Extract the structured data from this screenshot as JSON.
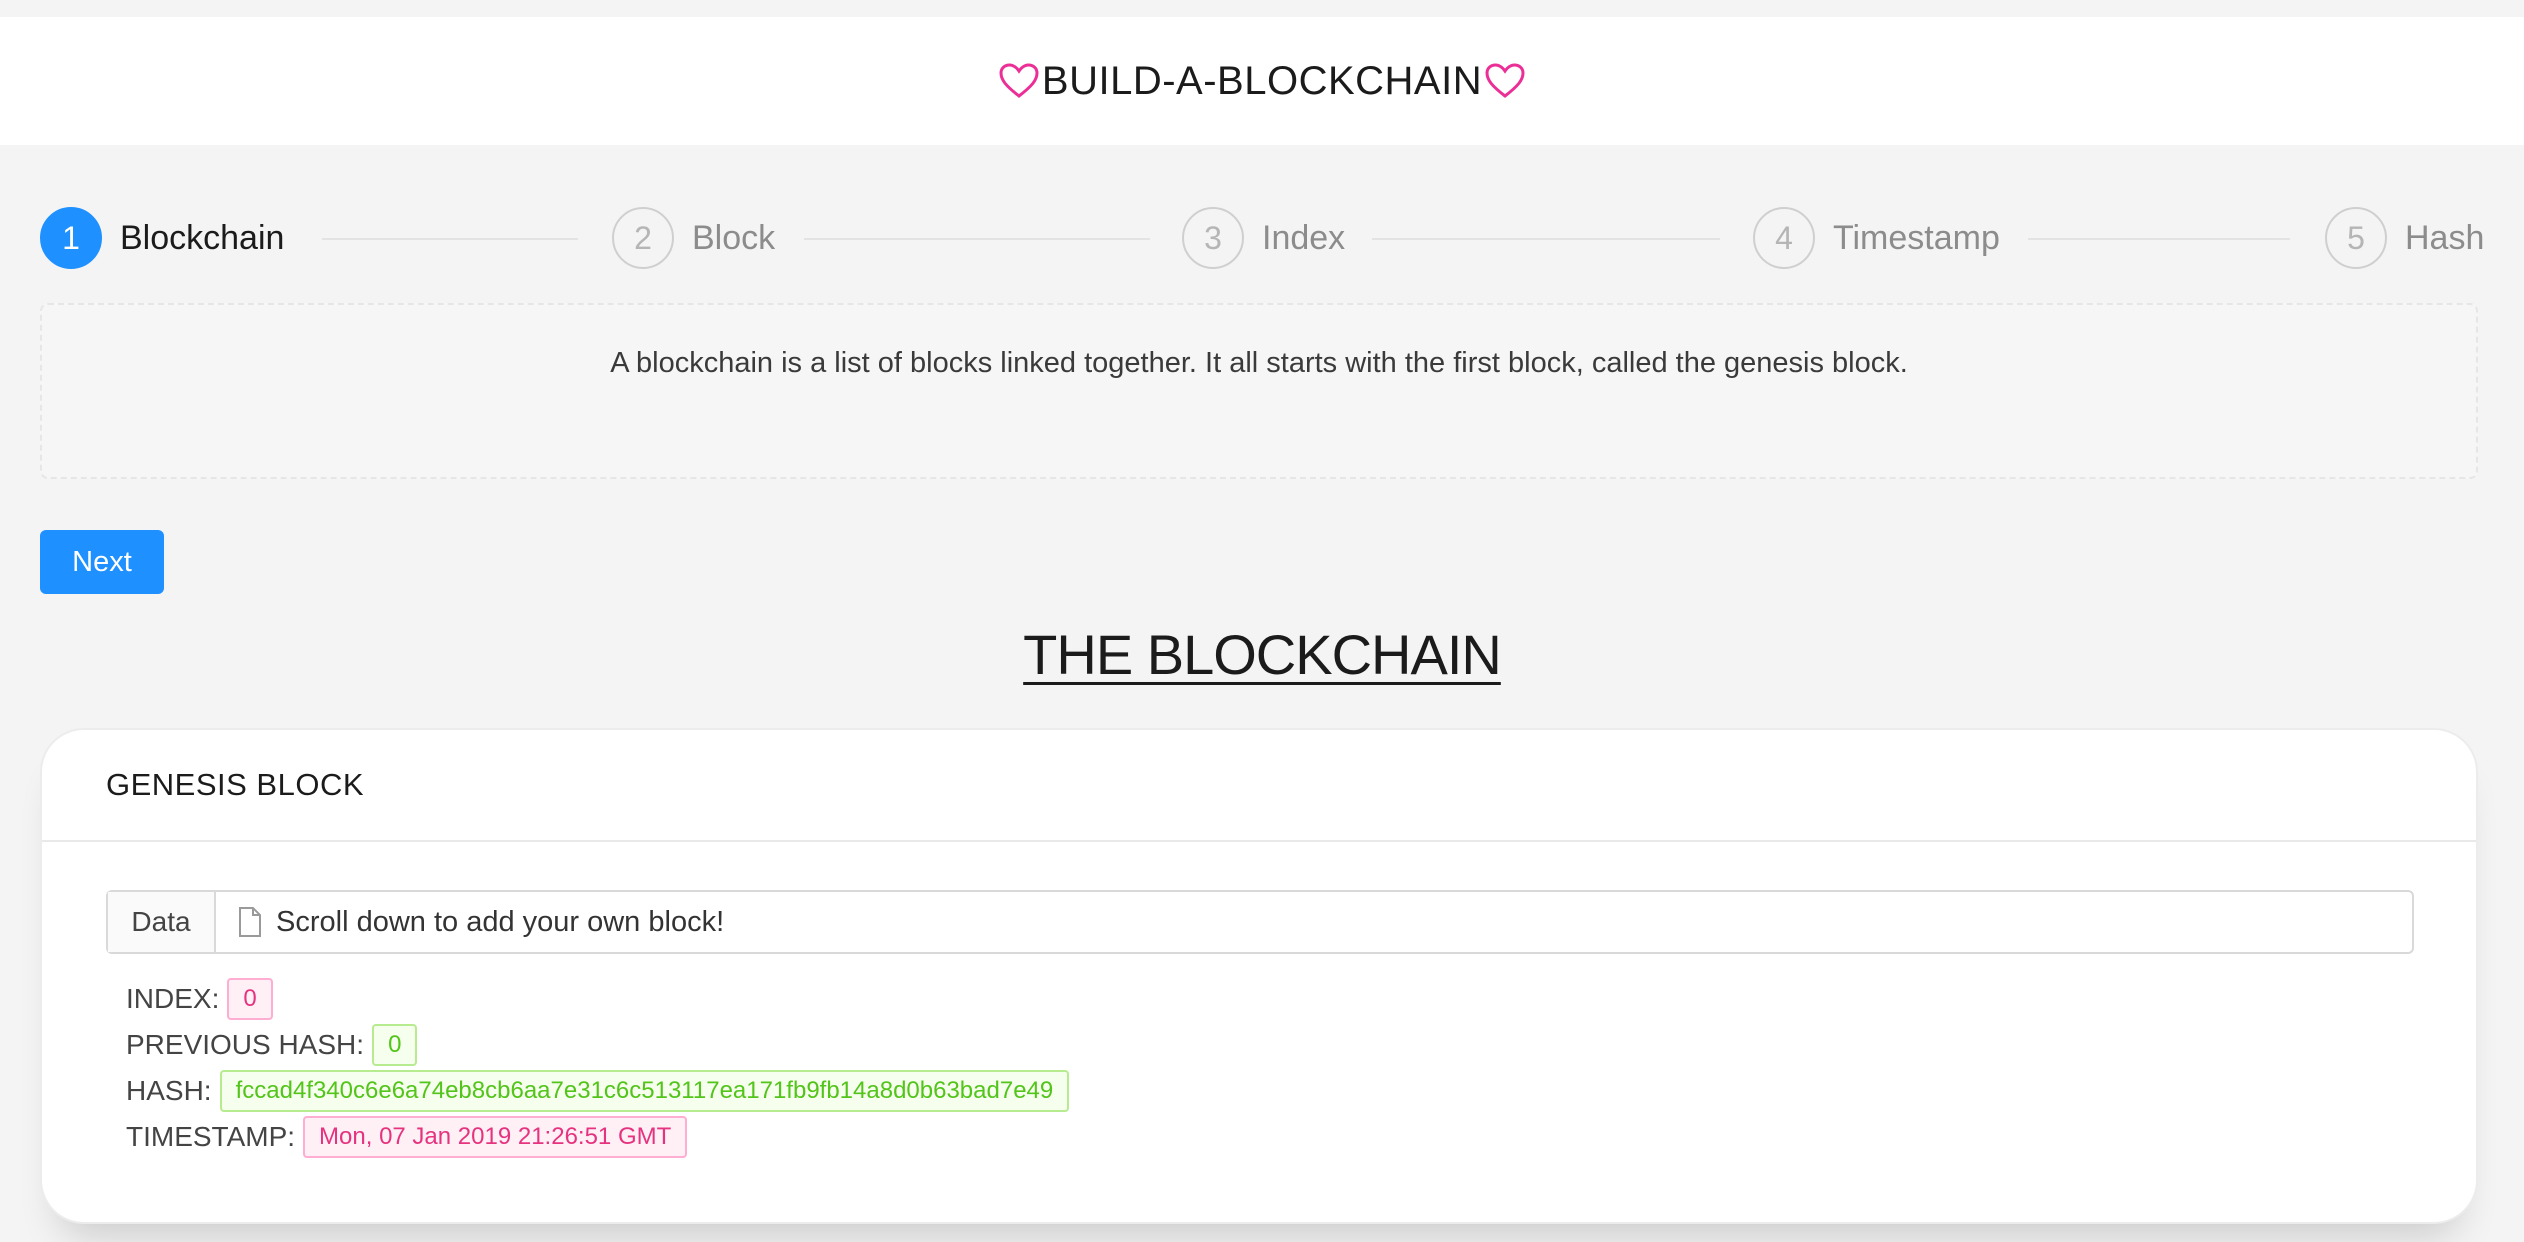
{
  "header": {
    "title": "BUILD-A-BLOCKCHAIN",
    "heart_icon_color": "#eb2f96"
  },
  "steps": [
    {
      "number": "1",
      "label": "Blockchain",
      "active": true
    },
    {
      "number": "2",
      "label": "Block",
      "active": false
    },
    {
      "number": "3",
      "label": "Index",
      "active": false
    },
    {
      "number": "4",
      "label": "Timestamp",
      "active": false
    },
    {
      "number": "5",
      "label": "Hash",
      "active": false
    }
  ],
  "description": "A blockchain is a list of blocks linked together. It all starts with the first block, called the genesis block.",
  "next_button": "Next",
  "chain_title": "THE BLOCKCHAIN",
  "block": {
    "title": "GENESIS BLOCK",
    "data_label": "Data",
    "data_value": "Scroll down to add your own block!",
    "index_label": "INDEX:",
    "index_value": "0",
    "prev_hash_label": "PREVIOUS HASH:",
    "prev_hash_value": "0",
    "hash_label": "HASH:",
    "hash_value": "fccad4f340c6e6a74eb8cb6aa7e31c6c513117ea171fb9fb14a8d0b63bad7e49",
    "timestamp_label": "TIMESTAMP:",
    "timestamp_value": "Mon, 07 Jan 2019 21:26:51 GMT"
  },
  "colors": {
    "accent": "#1f90ff",
    "pink": "#e5337f",
    "green": "#52c41a"
  }
}
